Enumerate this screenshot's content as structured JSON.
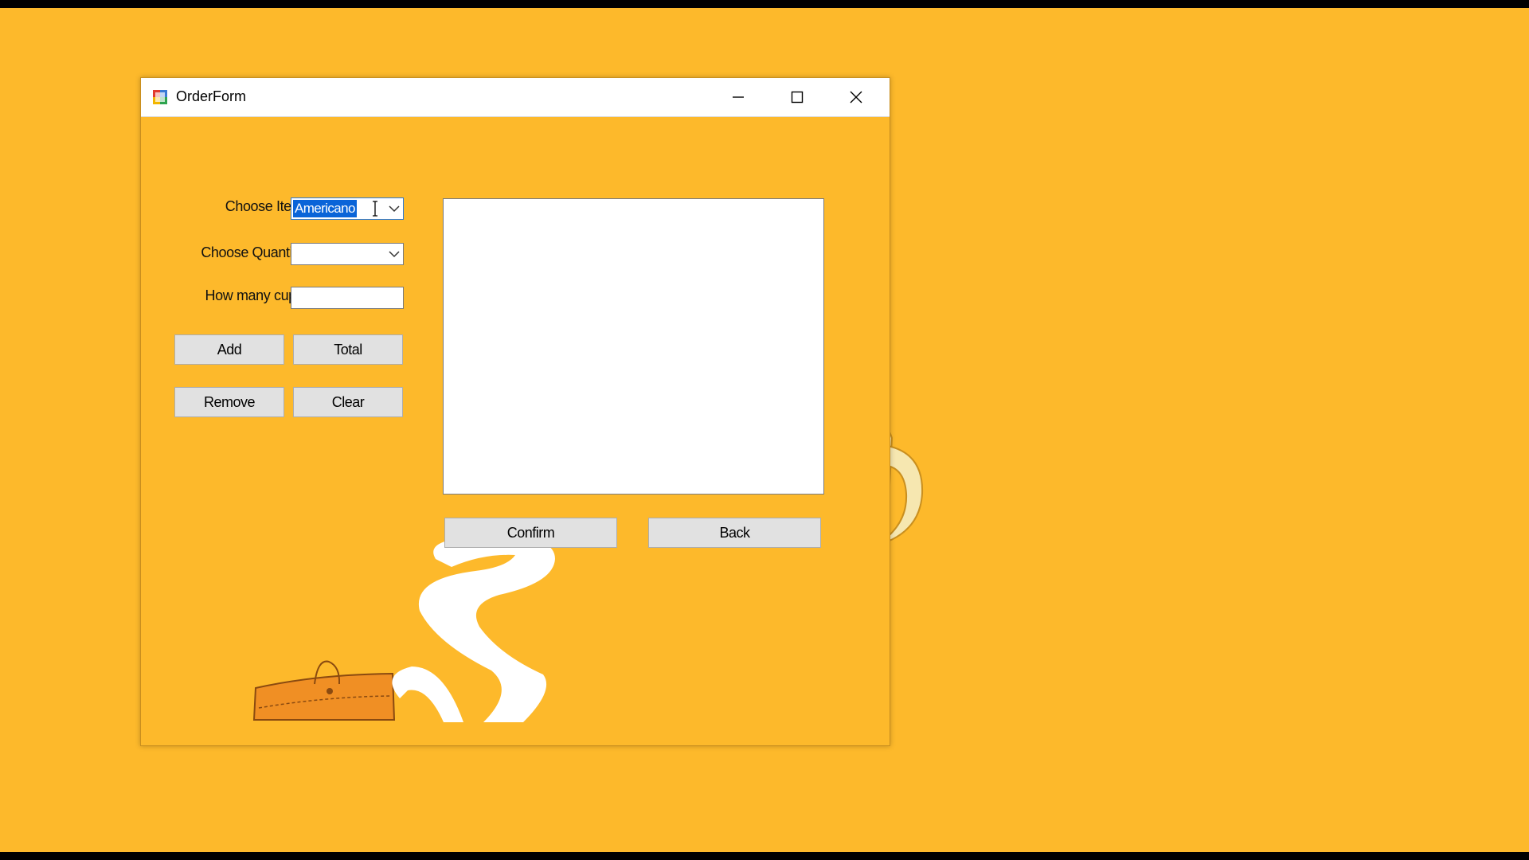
{
  "window": {
    "title": "OrderForm"
  },
  "form": {
    "choose_item_label": "Choose Item:",
    "choose_item_value": "Americano",
    "choose_quantity_label": "Choose Quantity:",
    "choose_quantity_value": "",
    "cups_label": "How many cups:",
    "cups_value": ""
  },
  "buttons": {
    "add": "Add",
    "total": "Total",
    "remove": "Remove",
    "clear": "Clear",
    "confirm": "Confirm",
    "back": "Back"
  },
  "order_list": {
    "items": []
  },
  "colors": {
    "background": "#FDB92B",
    "selection": "#0A64D8",
    "bag": "#F08F24",
    "steam": "#FFFFFF"
  },
  "icons": {
    "app": "app-icon",
    "minimize": "minimize-icon",
    "maximize": "maximize-icon",
    "close": "close-icon",
    "dropdown": "chevron-down-icon"
  }
}
